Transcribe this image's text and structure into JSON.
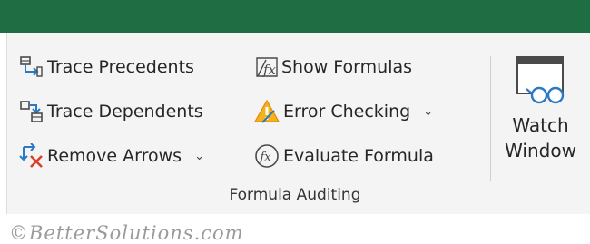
{
  "group": {
    "label": "Formula Auditing"
  },
  "buttons": {
    "trace_precedents": "Trace Precedents",
    "trace_dependents": "Trace Dependents",
    "remove_arrows": "Remove Arrows",
    "show_formulas": "Show Formulas",
    "error_checking": "Error Checking",
    "evaluate_formula": "Evaluate Formula",
    "watch_window_line1": "Watch",
    "watch_window_line2": "Window"
  },
  "dropdown_caret": "⌄",
  "watermark": "©BetterSolutions.com",
  "colors": {
    "title_bar": "#1f6e43",
    "ribbon_bg": "#f4f4f4",
    "arrow_blue": "#2b79c2",
    "remove_red": "#d9402b",
    "warning_orange": "#e8890c",
    "icon_gray": "#4a4a4a"
  },
  "icons": [
    "trace-precedents-icon",
    "trace-dependents-icon",
    "remove-arrows-icon",
    "show-formulas-icon",
    "error-checking-icon",
    "evaluate-formula-icon",
    "watch-window-icon"
  ]
}
